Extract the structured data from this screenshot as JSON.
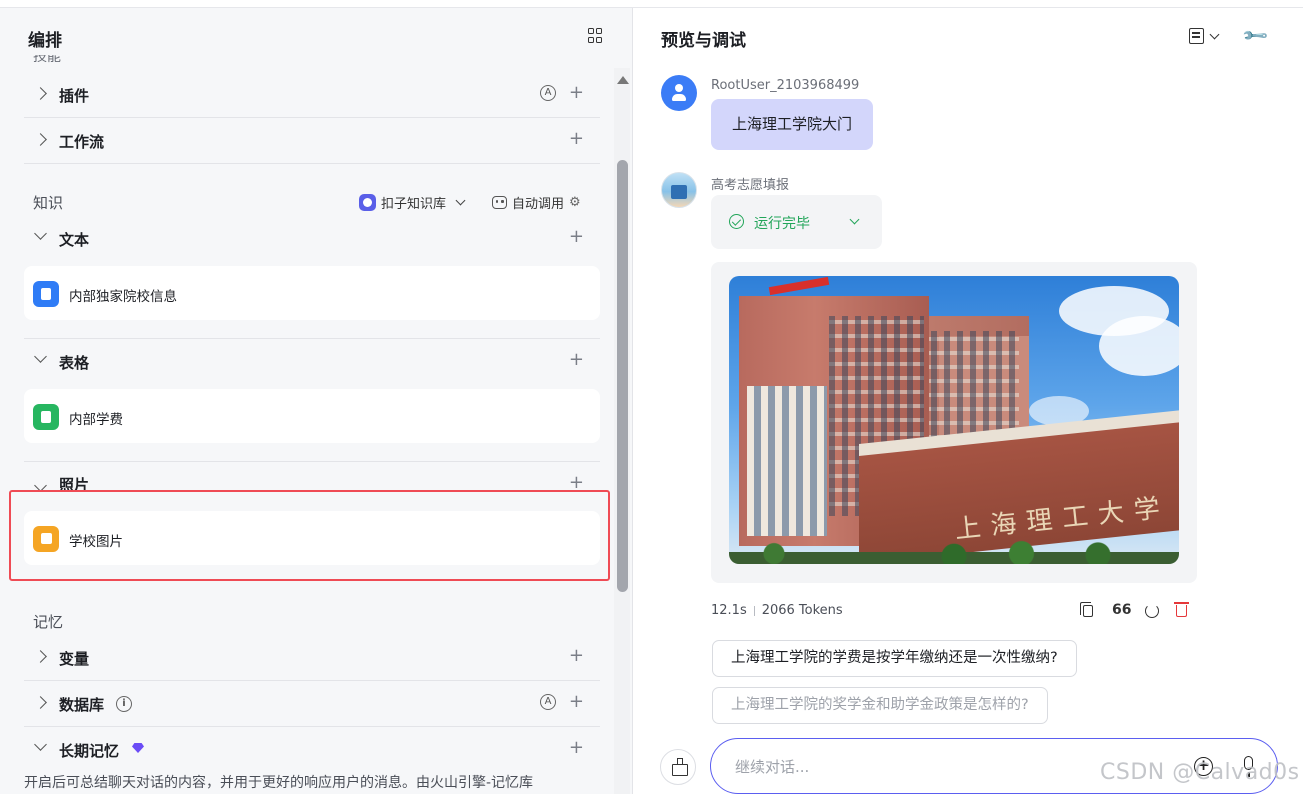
{
  "left": {
    "title": "编排",
    "cut_heading": "技能",
    "skills": [
      {
        "label": "插件"
      },
      {
        "label": "工作流"
      }
    ],
    "knowledge": {
      "title": "知识",
      "kb_select": "扣子知识库",
      "auto_call": "自动调用",
      "text_section": "文本",
      "text_item": "内部独家院校信息",
      "table_section": "表格",
      "table_item": "内部学费",
      "photo_section": "照片",
      "photo_item": "学校图片"
    },
    "memory": {
      "title": "记忆",
      "variables": "变量",
      "database": "数据库",
      "long_term": "长期记忆",
      "long_term_desc": "开启后可总结聊天对话的内容，并用于更好的响应用户的消息。由火山引擎-记忆库"
    },
    "plus_symbol": "+",
    "auto_symbol": "A",
    "info_symbol": "i"
  },
  "right": {
    "title": "预览与调试",
    "user": {
      "name": "RootUser_2103968499",
      "message": "上海理工学院大门"
    },
    "bot": {
      "name": "高考志愿填报",
      "status": "运行完毕",
      "photo_inscription": "上海理工大学"
    },
    "meta": {
      "duration": "12.1s",
      "tokens": "2066 Tokens"
    },
    "quote_symbol": "66",
    "suggestions": [
      "上海理工学院的学费是按学年缴纳还是一次性缴纳?",
      "上海理工学院的奖学金和助学金政策是怎样的?"
    ],
    "input": {
      "placeholder": "继续对话..."
    },
    "plus_symbol": "+"
  },
  "watermark": "CSDN @Calvad0s",
  "colors": {
    "accent": "#5b5ef0",
    "success": "#22a559",
    "highlight": "#ef4b55",
    "danger": "#e5383b"
  },
  "icons": [
    "grid-icon",
    "chevron-right-icon",
    "chevron-down-icon",
    "plus-icon",
    "auto-icon",
    "kb-logo-icon",
    "robot-icon",
    "gear-icon",
    "file-icon",
    "sheet-icon",
    "image-icon",
    "info-icon",
    "gem-icon",
    "history-icon",
    "wrench-icon",
    "user-avatar-icon",
    "check-circle-icon",
    "copy-icon",
    "quote-icon",
    "retry-icon",
    "trash-icon",
    "brush-icon",
    "plus-circle-icon",
    "mic-icon"
  ]
}
